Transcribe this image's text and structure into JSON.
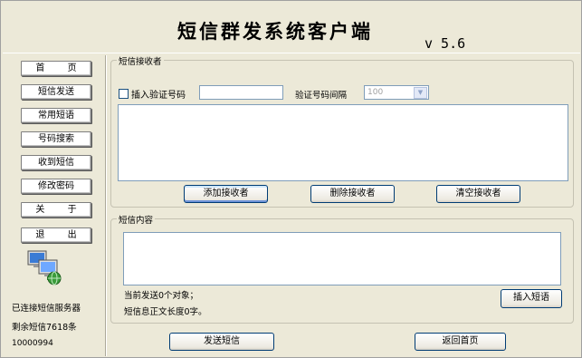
{
  "header": {
    "title": "短信群发系统客户端",
    "version": "v 5.6"
  },
  "nav": {
    "items": [
      {
        "label": "首 页",
        "name": "nav-home-button"
      },
      {
        "label": "短信发送",
        "name": "nav-send-sms-button"
      },
      {
        "label": "常用短语",
        "name": "nav-common-phrases-button"
      },
      {
        "label": "号码搜索",
        "name": "nav-number-search-button"
      },
      {
        "label": "收到短信",
        "name": "nav-inbox-button"
      },
      {
        "label": "修改密码",
        "name": "nav-change-password-button"
      },
      {
        "label": "关 于",
        "name": "nav-about-button"
      },
      {
        "label": "退 出",
        "name": "nav-exit-button"
      }
    ],
    "status": {
      "connected": "已连接短信服务器",
      "remaining": "剩余短信7618条",
      "account": "10000994"
    },
    "icon": "network-computer-icon"
  },
  "recipients": {
    "group_label": "短信接收者",
    "insert_code_label": "插入验证号码",
    "insert_code_checked": false,
    "code_value": "",
    "interval_label": "验证号码间隔",
    "interval_value": "100",
    "add_label": "添加接收者",
    "delete_label": "删除接收者",
    "clear_label": "清空接收者"
  },
  "content": {
    "group_label": "短信内容",
    "text": "",
    "objects_count_text": "当前发送0个对象；",
    "length_text": "短信息正文长度0字。",
    "insert_phrase_label": "插入短语"
  },
  "footer": {
    "send_label": "发送短信",
    "home_label": "返回首页"
  },
  "colors": {
    "window_bg": "#ece9d8",
    "button_border": "#003c74",
    "input_border": "#7f9db9"
  }
}
